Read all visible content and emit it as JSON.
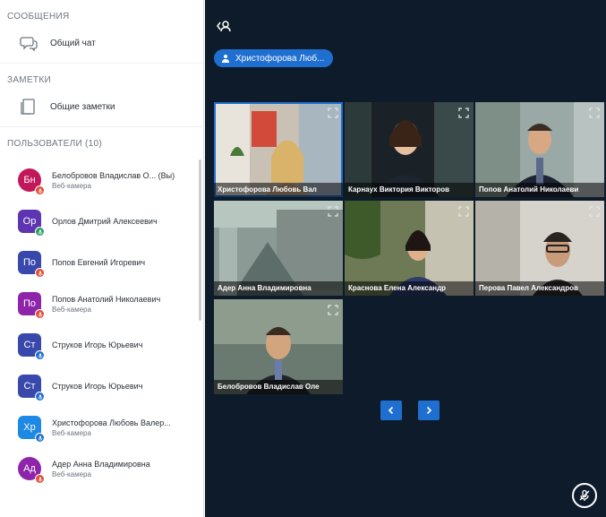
{
  "sidebar": {
    "messages_header": "СООБЩЕНИЯ",
    "public_chat_label": "Общий чат",
    "notes_header": "ЗАМЕТКИ",
    "shared_notes_label": "Общие заметки",
    "users_header": "ПОЛЬЗОВАТЕЛИ (10)",
    "users": [
      {
        "initials": "Бн",
        "name": "Белобровов Владислав О... (Вы)",
        "role": "Веб-камера",
        "color": "#c2185b",
        "mic": "red",
        "round": true
      },
      {
        "initials": "Ор",
        "name": "Орлов Дмитрий Алексеевич",
        "role": "",
        "color": "#5e35b1",
        "mic": "green",
        "round": false
      },
      {
        "initials": "По",
        "name": "Попов Евгений Игоревич",
        "role": "",
        "color": "#3949ab",
        "mic": "red",
        "round": false
      },
      {
        "initials": "По",
        "name": "Попов Анатолий Николаевич",
        "role": "Веб-камера",
        "color": "#8e24aa",
        "mic": "red",
        "round": false
      },
      {
        "initials": "Ст",
        "name": "Струков Игорь Юрьевич",
        "role": "",
        "color": "#3949ab",
        "mic": "blue",
        "round": false
      },
      {
        "initials": "Ст",
        "name": "Струков Игорь Юрьевич",
        "role": "",
        "color": "#3949ab",
        "mic": "blue",
        "round": false
      },
      {
        "initials": "Хр",
        "name": "Христофорова Любовь Валер...",
        "role": "Веб-камера",
        "color": "#1e88e5",
        "mic": "blue",
        "round": false
      },
      {
        "initials": "Ад",
        "name": "Адер Анна Владимировна",
        "role": "Веб-камера",
        "color": "#8e24aa",
        "mic": "red",
        "round": true
      }
    ]
  },
  "main": {
    "presenter_label": "Христофорова Люб...",
    "tiles": [
      {
        "caption": "Христофорова Любовь Вал",
        "active": true,
        "scene": "a"
      },
      {
        "caption": "Карнаух Виктория Викторов",
        "active": false,
        "scene": "b"
      },
      {
        "caption": "Попов Анатолий Николаеви",
        "active": false,
        "scene": "c"
      },
      {
        "caption": "Адер Анна Владимировна",
        "active": false,
        "scene": "d"
      },
      {
        "caption": "Краснова Елена Александр",
        "active": false,
        "scene": "e"
      },
      {
        "caption": "Перова Павел Александров",
        "active": false,
        "scene": "f"
      },
      {
        "caption": "Белобровов Владислав Оле",
        "active": false,
        "scene": "g"
      }
    ]
  },
  "colors": {
    "accent": "#1f6fd0",
    "main_bg": "#0d1b2a",
    "mic_red": "#e24d3a",
    "mic_green": "#2d9e63"
  }
}
